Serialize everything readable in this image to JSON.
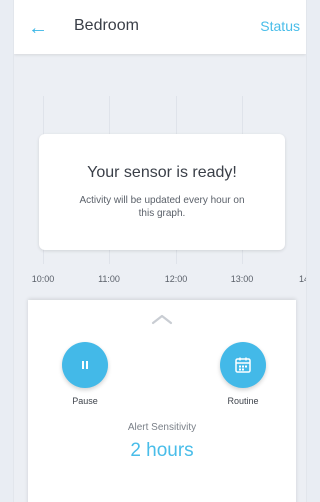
{
  "header": {
    "back_icon": "arrow-left-icon",
    "title": "Bedroom",
    "status_label": "Status"
  },
  "graph": {
    "time_labels": [
      "10:00",
      "11:00",
      "12:00",
      "13:00",
      "14"
    ],
    "card": {
      "title": "Your sensor is ready!",
      "text": "Activity will be updated every hour on this graph."
    }
  },
  "panel": {
    "collapse_icon": "chevron-up-icon",
    "actions": [
      {
        "label": "Pause",
        "icon": "pause-icon"
      },
      {
        "label": "Routine",
        "icon": "calendar-icon"
      }
    ],
    "sensitivity_label": "Alert Sensitivity",
    "sensitivity_value": "2 hours"
  },
  "colors": {
    "accent": "#43b9e8",
    "text_dark": "#3a3f48",
    "background": "#eceff4"
  }
}
